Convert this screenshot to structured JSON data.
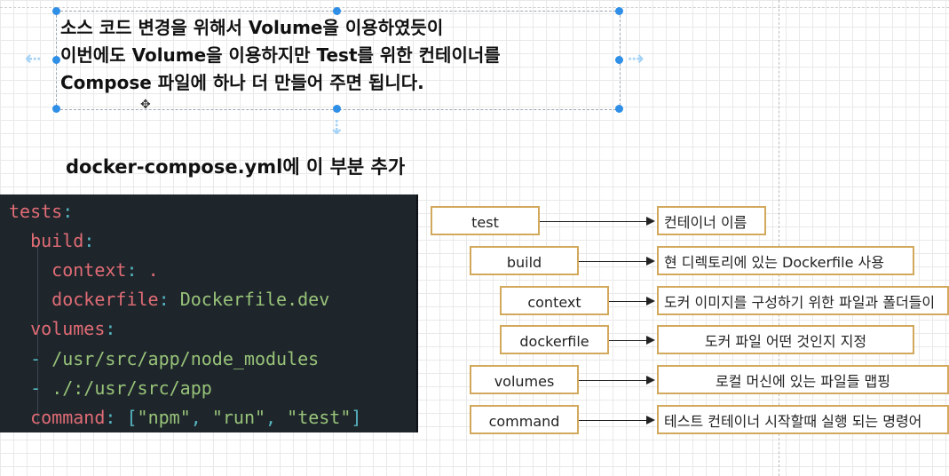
{
  "intro": {
    "lines": [
      "소스 코드 변경을 위해서 Volume을 이용하였듯이",
      "이번에도 Volume을 이용하지만 Test를 위한 컨테이너를",
      "Compose 파일에 하나 더 만들어 주면 됩니다."
    ]
  },
  "subtitle": "docker-compose.yml에 이 부분 추가",
  "code": {
    "tests_key": "tests",
    "build_key": "build",
    "context_key": "context",
    "context_value": ".",
    "dockerfile_key": "dockerfile",
    "dockerfile_value": "Dockerfile.dev",
    "volumes_key": "volumes",
    "volume_1": "/usr/src/app/node_modules",
    "volume_2": "./:/usr/src/app",
    "command_key": "command",
    "command_values": [
      "npm",
      "run",
      "test"
    ]
  },
  "mappings": [
    {
      "term": "test",
      "description": "컨테이너 이름"
    },
    {
      "term": "build",
      "description": "현 디렉토리에 있는 Dockerfile 사용"
    },
    {
      "term": "context",
      "description": "도커 이미지를 구성하기 위한 파일과 폴더들이"
    },
    {
      "term": "dockerfile",
      "description": "도커 파일 어떤 것인지 지정"
    },
    {
      "term": "volumes",
      "description": "로컬 머신에 있는 파일들 맵핑"
    },
    {
      "term": "command",
      "description": "테스트 컨테이너 시작할때 실행 되는 명령어"
    }
  ],
  "colors": {
    "box_border": "#d2a95c",
    "code_background": "#1e252b",
    "selection_handle": "#2f8fe6"
  }
}
